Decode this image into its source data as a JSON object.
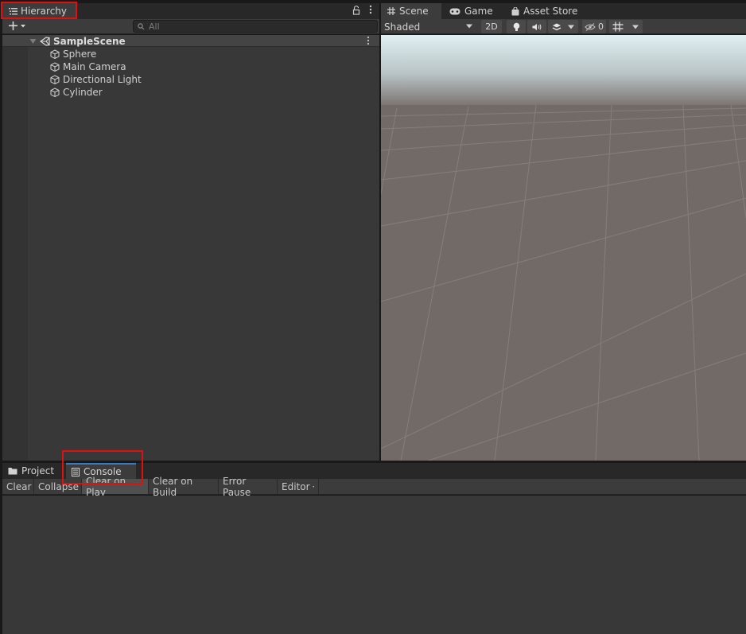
{
  "hierarchy": {
    "tab_label": "Hierarchy",
    "search_placeholder": "All",
    "scene_name": "SampleScene",
    "objects": [
      "Sphere",
      "Main Camera",
      "Directional Light",
      "Cylinder"
    ]
  },
  "scene_view": {
    "tabs": [
      "Scene",
      "Game",
      "Asset Store"
    ],
    "shading_mode": "Shaded",
    "toggle_2d": "2D",
    "hidden_count": "0"
  },
  "console": {
    "tabs": [
      "Project",
      "Console"
    ],
    "buttons": [
      "Clear",
      "Collapse",
      "Clear on Play",
      "Clear on Build",
      "Error Pause",
      "Editor"
    ]
  },
  "colors": {
    "highlight_outline": "#e01010",
    "panel_bg": "#383838",
    "ground": "#726a66",
    "sky": "#dfeff2"
  },
  "icons": [
    "hierarchy-icon",
    "lock-icon",
    "kebab-menu-icon",
    "plus-icon",
    "search-icon",
    "unity-scene-icon",
    "gameobject-cube-icon",
    "grid-icon",
    "gamepad-icon",
    "shopping-bag-icon",
    "lightbulb-icon",
    "speaker-icon",
    "effects-icon",
    "visibility-icon",
    "gizmo-grid-icon",
    "folder-icon",
    "console-icon"
  ]
}
